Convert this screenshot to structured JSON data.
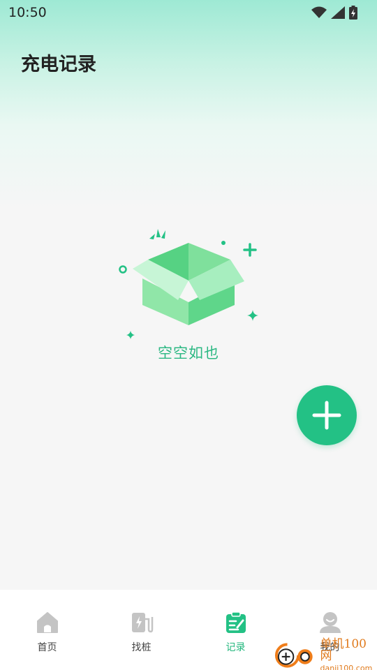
{
  "status_bar": {
    "time": "10:50"
  },
  "header": {
    "title": "充电记录"
  },
  "empty_state": {
    "text": "空空如也"
  },
  "bottom_nav": {
    "items": [
      {
        "label": "首页",
        "icon": "home-icon"
      },
      {
        "label": "找桩",
        "icon": "charger-icon"
      },
      {
        "label": "记录",
        "icon": "records-icon",
        "active": true
      },
      {
        "label": "我的",
        "icon": "user-icon"
      }
    ]
  },
  "watermark": {
    "main": "单机100网",
    "sub": "danji100.com"
  },
  "colors": {
    "accent": "#23c185",
    "empty_text": "#2cb883",
    "box_green": "#5fd68a"
  }
}
